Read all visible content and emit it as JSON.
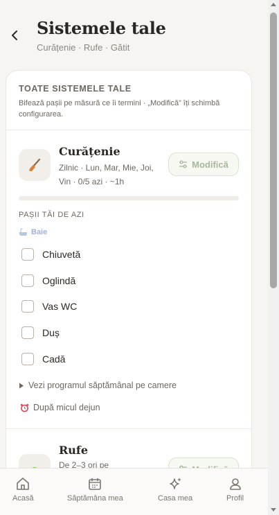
{
  "header": {
    "title": "Sistemele tale",
    "subtitle": "Curățenie · Rufe · Gătit"
  },
  "card": {
    "section_title": "TOATE SISTEMELE TALE",
    "section_desc": "Bifează pașii pe măsură ce îi termini · „Modifică” îți schimbă configurarea."
  },
  "systems": [
    {
      "name": "Curățenie",
      "meta": "Zilnic · Lun, Mar, Mie, Joi, Vin · 0/5 azi · ~1h",
      "edit_label": "Modifică",
      "icon": "broom-icon",
      "progress": 0
    },
    {
      "name": "Rufe",
      "meta": "De 2–3 ori pe",
      "edit_label": "Modifică",
      "icon": "laundry-icon"
    }
  ],
  "today": {
    "label": "PAȘII TĂI DE AZI",
    "room": "Baie",
    "tasks": [
      "Chiuvetă",
      "Oglindă",
      "Vas WC",
      "Duș",
      "Cadă"
    ],
    "weekly_toggle": "Vezi programul săptămânal pe camere",
    "reminder": "După micul dejun"
  },
  "nav": {
    "items": [
      {
        "label": "Acasă",
        "icon": "home-icon"
      },
      {
        "label": "Săptămâna mea",
        "icon": "calendar-icon"
      },
      {
        "label": "Casa mea",
        "icon": "sparkle-icon"
      },
      {
        "label": "Profil",
        "icon": "user-icon"
      }
    ]
  },
  "colors": {
    "background": "#f7f5f1",
    "accent_green": "#a7b89b",
    "room_blue": "#9fb3d4",
    "text": "#2b2824"
  }
}
